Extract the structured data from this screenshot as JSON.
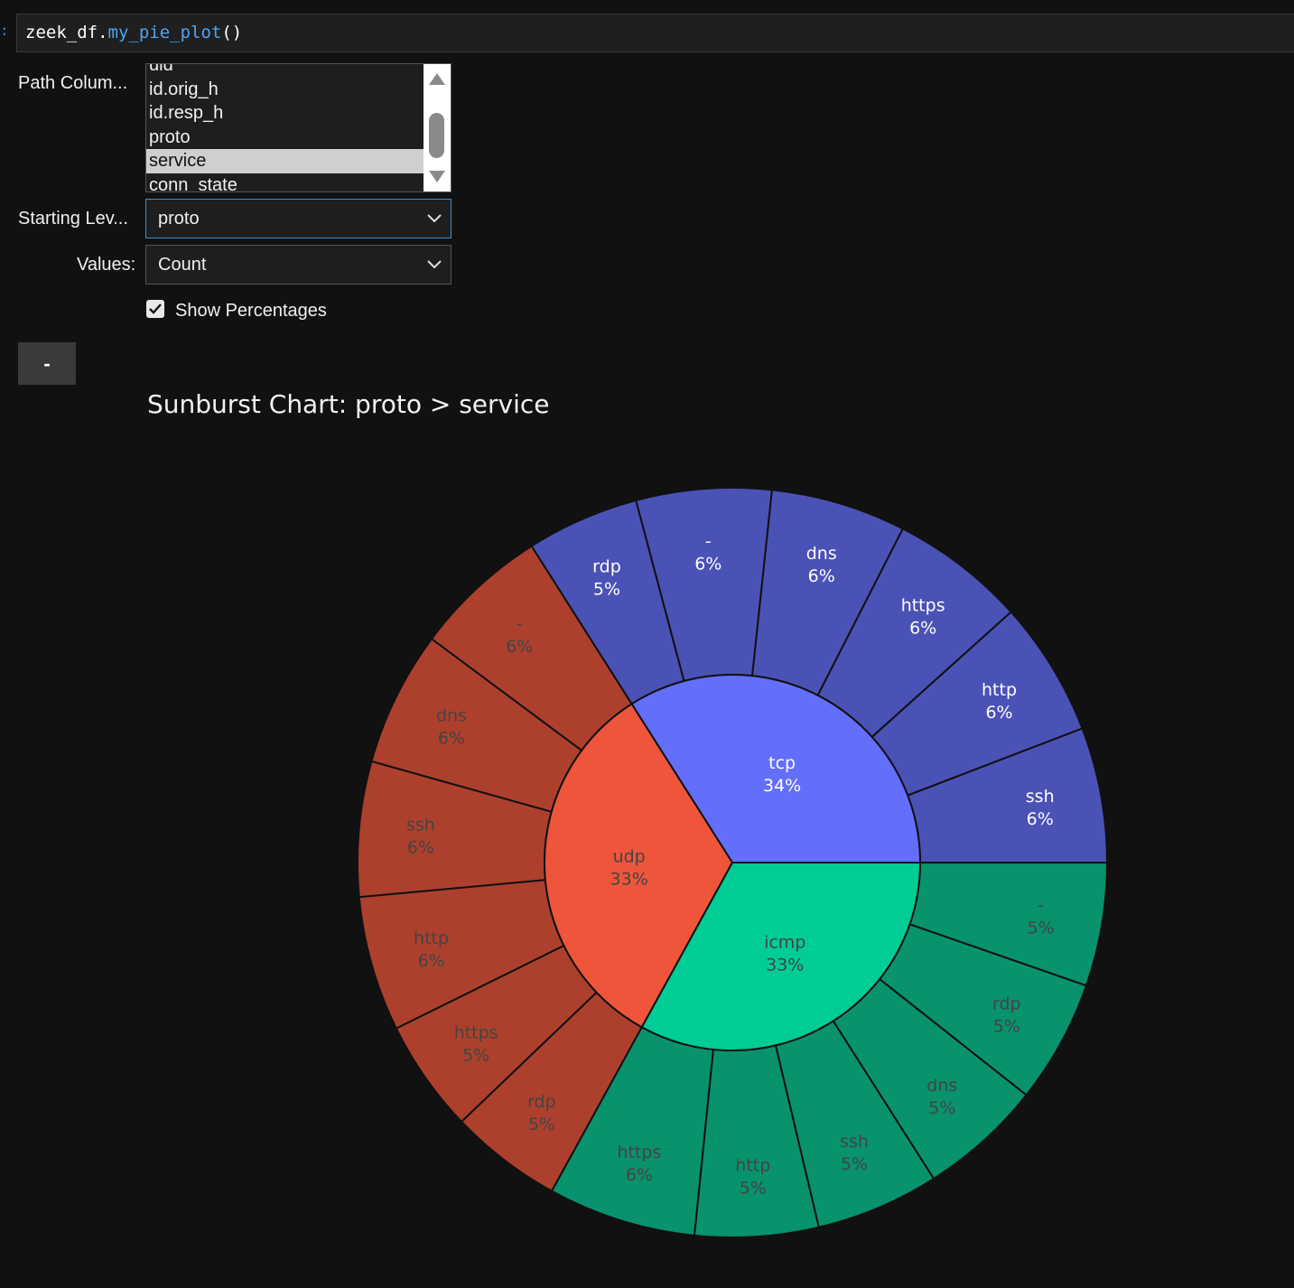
{
  "cell": {
    "prompt": ":",
    "code_object": "zeek_df.",
    "code_method": "my_pie_plot",
    "code_parens": "()"
  },
  "controls": {
    "path_columns_label": "Path Colum...",
    "path_columns_items": [
      {
        "label": "uid",
        "selected": false
      },
      {
        "label": "id.orig_h",
        "selected": false
      },
      {
        "label": "id.resp_h",
        "selected": false
      },
      {
        "label": "proto",
        "selected": false
      },
      {
        "label": "service",
        "selected": true
      },
      {
        "label": "conn_state",
        "selected": false
      }
    ],
    "starting_level_label": "Starting Lev...",
    "starting_level_value": "proto",
    "values_label": "Values:",
    "values_value": "Count",
    "show_percentages_label": "Show Percentages",
    "show_percentages_checked": true,
    "action_button_label": "-"
  },
  "icons": {
    "scroll_up": "triangle-up-icon",
    "scroll_down": "triangle-down-icon",
    "dropdown": "chevron-down-icon",
    "checkbox": "check-icon"
  },
  "chart_data": {
    "type": "sunburst",
    "title": "Sunburst Chart: proto > service",
    "rings": [
      "proto",
      "service"
    ],
    "nodes": [
      {
        "label": "tcp",
        "percent": 34,
        "color": "#636efa",
        "child_color": "#4a52b5",
        "text_color": "#ffffff",
        "children": [
          {
            "label": "ssh",
            "percent": 6
          },
          {
            "label": "http",
            "percent": 6
          },
          {
            "label": "https",
            "percent": 6
          },
          {
            "label": "dns",
            "percent": 6
          },
          {
            "label": "-",
            "percent": 6
          },
          {
            "label": "rdp",
            "percent": 5
          }
        ]
      },
      {
        "label": "udp",
        "percent": 33,
        "color": "#ef553b",
        "child_color": "#ad402d",
        "text_color": "#444444",
        "children": [
          {
            "label": "-",
            "percent": 6
          },
          {
            "label": "dns",
            "percent": 6
          },
          {
            "label": "ssh",
            "percent": 6
          },
          {
            "label": "http",
            "percent": 6
          },
          {
            "label": "https",
            "percent": 5
          },
          {
            "label": "rdp",
            "percent": 5
          }
        ]
      },
      {
        "label": "icmp",
        "percent": 33,
        "color": "#00cc96",
        "child_color": "#08926d",
        "text_color": "#444444",
        "children": [
          {
            "label": "https",
            "percent": 6
          },
          {
            "label": "http",
            "percent": 5
          },
          {
            "label": "ssh",
            "percent": 5
          },
          {
            "label": "dns",
            "percent": 5
          },
          {
            "label": "rdp",
            "percent": 5
          },
          {
            "label": "-",
            "percent": 5
          }
        ]
      }
    ],
    "colors": {
      "background": "#111111",
      "border": "#111111"
    }
  }
}
